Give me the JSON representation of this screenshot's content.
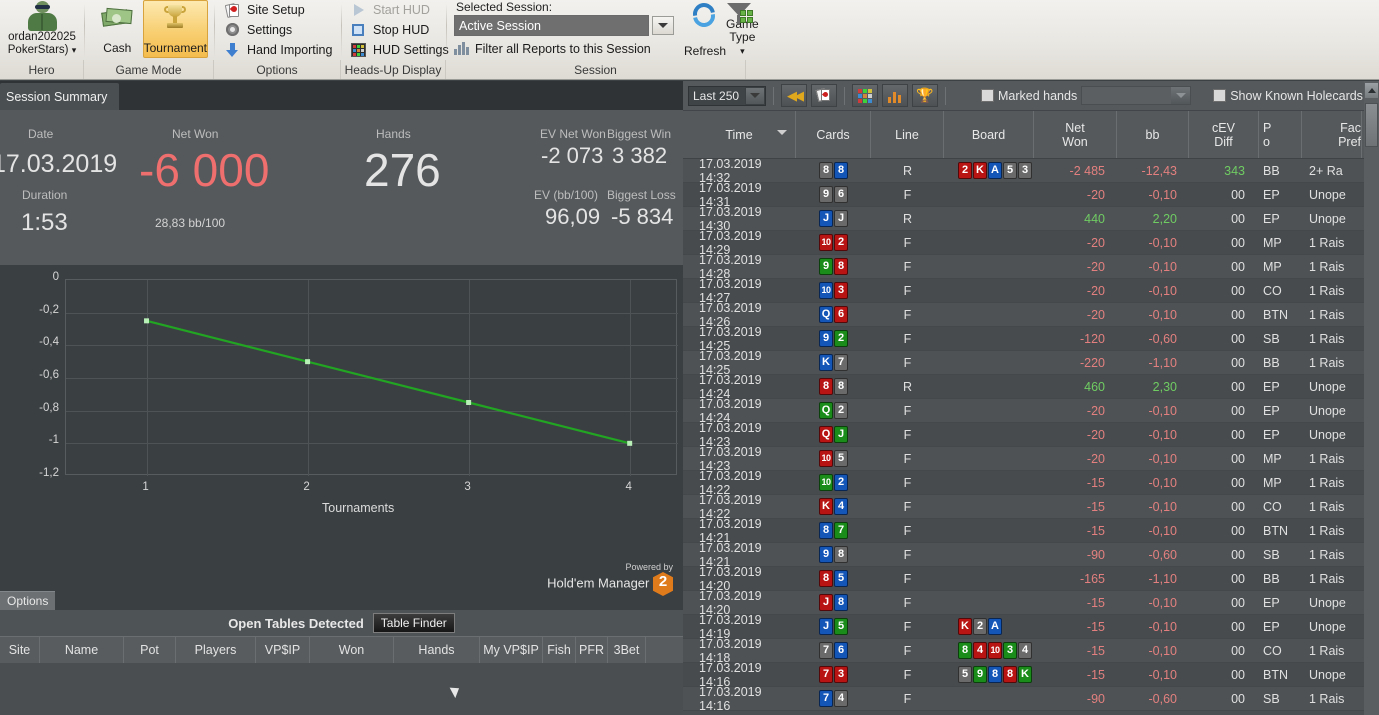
{
  "ribbon": {
    "hero": {
      "group_label": "Hero",
      "name_line1": "ordan202025",
      "name_line2": "PokerStars)",
      "avatar_icon": "user-avatar-icon"
    },
    "game_mode": {
      "group_label": "Game Mode",
      "cash_label": "Cash",
      "tournament_label": "Tournament",
      "selected": "Tournament"
    },
    "options": {
      "group_label": "Options",
      "items": [
        {
          "label": "Site Setup",
          "icon": "cards-icon"
        },
        {
          "label": "Settings",
          "icon": "gear-icon"
        },
        {
          "label": "Hand Importing",
          "icon": "download-arrow-icon"
        }
      ]
    },
    "hud": {
      "group_label": "Heads-Up Display",
      "items": [
        {
          "label": "Start HUD",
          "icon": "play-icon",
          "disabled": true
        },
        {
          "label": "Stop HUD",
          "icon": "stop-icon",
          "disabled": false
        },
        {
          "label": "HUD Settings",
          "icon": "hud-grid-icon",
          "disabled": false
        }
      ]
    },
    "session": {
      "group_label": "Session",
      "selected_session_label": "Selected Session:",
      "selected_session_value": "Active Session",
      "filter_label": "Filter all Reports to this Session",
      "refresh_label": "Refresh",
      "game_type_line1": "Game",
      "game_type_line2": "Type"
    }
  },
  "left_panel": {
    "tab_label": "Session Summary",
    "summary": {
      "date_label": "Date",
      "date_value": "17.03.2019",
      "duration_label": "Duration",
      "duration_value": "1:53",
      "netwon_label": "Net Won",
      "netwon_value": "-6 000",
      "netwon_sub": "28,83 bb/100",
      "hands_label": "Hands",
      "hands_value": "276",
      "ev_netwon_label": "EV Net Won",
      "ev_netwon_value": "-2 073",
      "biggest_win_label": "Biggest Win",
      "biggest_win_value": "3 382",
      "ev_bb_label": "EV (bb/100)",
      "ev_bb_value": "96,09",
      "biggest_loss_label": "Biggest Loss",
      "biggest_loss_value": "-5 834"
    },
    "chart_footer": {
      "options_button": "Options",
      "powered_by": "Powered by",
      "brand": "Hold'em Manager",
      "brand_badge": "2"
    },
    "tables": {
      "title": "Open Tables Detected",
      "finder_button": "Table Finder",
      "columns": [
        "Site",
        "Name",
        "Pot",
        "Players",
        "VP$IP",
        "Won",
        "Hands",
        "My VP$IP",
        "Fish",
        "PFR",
        "3Bet"
      ],
      "rows": []
    }
  },
  "chart_data": {
    "type": "line",
    "title": "",
    "xlabel": "Tournaments",
    "ylabel": "",
    "x": [
      1,
      2,
      3,
      4
    ],
    "values": [
      -0.25,
      -0.5,
      -0.75,
      -1.0
    ],
    "xticks": [
      "1",
      "2",
      "3",
      "4"
    ],
    "yticks": [
      "0",
      "-0,2",
      "-0,4",
      "-0,6",
      "-0,8",
      "-1",
      "-1,2"
    ],
    "ylim": [
      -1.2,
      0
    ],
    "xlim": [
      0.5,
      4.3
    ],
    "grid": true,
    "legend": "none",
    "line_color": "#22a522",
    "marker_color": "#b8f0b8"
  },
  "right_panel": {
    "toolbar": {
      "range_value": "Last 250",
      "marked_hands_label": "Marked hands",
      "marked_hands_value": "",
      "show_known_holecards_label": "Show Known Holecards",
      "buttons": [
        "rewind-icon",
        "cards-icon",
        "grid-icon",
        "bar-chart-icon",
        "trophy-icon"
      ]
    },
    "columns": [
      {
        "key": "time",
        "label": "Time",
        "sorted": true
      },
      {
        "key": "cards",
        "label": "Cards"
      },
      {
        "key": "line",
        "label": "Line"
      },
      {
        "key": "board",
        "label": "Board"
      },
      {
        "key": "net",
        "label": "Net\nWon",
        "l1": "Net",
        "l2": "Won"
      },
      {
        "key": "bb",
        "label": "bb"
      },
      {
        "key": "cev",
        "l1": "cEV",
        "l2": "Diff"
      },
      {
        "key": "pos",
        "l1": "P",
        "l2": "o"
      },
      {
        "key": "fac",
        "l1": "Fac",
        "l2": "Pref"
      }
    ],
    "rows": [
      {
        "time": "17.03.2019 14:32",
        "cards": [
          {
            "r": "8",
            "c": "s"
          },
          {
            "r": "8",
            "c": "b"
          }
        ],
        "line": "R",
        "board": [
          {
            "r": "2",
            "c": "r"
          },
          {
            "r": "K",
            "c": "r"
          },
          {
            "r": "A",
            "c": "b"
          },
          {
            "r": "5",
            "c": "s"
          },
          {
            "r": "3",
            "c": "s"
          }
        ],
        "net": "-2 485",
        "net_sign": "neg",
        "bb": "-12,43",
        "bb_sign": "neg",
        "cev": "343",
        "cev_sign": "pos",
        "pos": "BB",
        "fac": "2+ Ra"
      },
      {
        "time": "17.03.2019 14:31",
        "cards": [
          {
            "r": "9",
            "c": "s"
          },
          {
            "r": "6",
            "c": "s"
          }
        ],
        "line": "F",
        "board": [],
        "net": "-20",
        "net_sign": "neg",
        "bb": "-0,10",
        "bb_sign": "neg",
        "cev": "00",
        "cev_sign": "",
        "pos": "EP",
        "fac": "Unope"
      },
      {
        "time": "17.03.2019 14:30",
        "cards": [
          {
            "r": "J",
            "c": "b"
          },
          {
            "r": "J",
            "c": "s"
          }
        ],
        "line": "R",
        "board": [],
        "net": "440",
        "net_sign": "pos",
        "bb": "2,20",
        "bb_sign": "pos",
        "cev": "00",
        "cev_sign": "",
        "pos": "EP",
        "fac": "Unope"
      },
      {
        "time": "17.03.2019 14:29",
        "cards": [
          {
            "r": "10",
            "c": "r"
          },
          {
            "r": "2",
            "c": "r"
          }
        ],
        "line": "F",
        "board": [],
        "net": "-20",
        "net_sign": "neg",
        "bb": "-0,10",
        "bb_sign": "neg",
        "cev": "00",
        "cev_sign": "",
        "pos": "MP",
        "fac": "1 Rais"
      },
      {
        "time": "17.03.2019 14:28",
        "cards": [
          {
            "r": "9",
            "c": "g"
          },
          {
            "r": "8",
            "c": "r"
          }
        ],
        "line": "F",
        "board": [],
        "net": "-20",
        "net_sign": "neg",
        "bb": "-0,10",
        "bb_sign": "neg",
        "cev": "00",
        "cev_sign": "",
        "pos": "MP",
        "fac": "1 Rais"
      },
      {
        "time": "17.03.2019 14:27",
        "cards": [
          {
            "r": "10",
            "c": "b"
          },
          {
            "r": "3",
            "c": "r"
          }
        ],
        "line": "F",
        "board": [],
        "net": "-20",
        "net_sign": "neg",
        "bb": "-0,10",
        "bb_sign": "neg",
        "cev": "00",
        "cev_sign": "",
        "pos": "CO",
        "fac": "1 Rais"
      },
      {
        "time": "17.03.2019 14:26",
        "cards": [
          {
            "r": "Q",
            "c": "b"
          },
          {
            "r": "6",
            "c": "r"
          }
        ],
        "line": "F",
        "board": [],
        "net": "-20",
        "net_sign": "neg",
        "bb": "-0,10",
        "bb_sign": "neg",
        "cev": "00",
        "cev_sign": "",
        "pos": "BTN",
        "fac": "1 Rais"
      },
      {
        "time": "17.03.2019 14:25",
        "cards": [
          {
            "r": "9",
            "c": "b"
          },
          {
            "r": "2",
            "c": "g"
          }
        ],
        "line": "F",
        "board": [],
        "net": "-120",
        "net_sign": "neg",
        "bb": "-0,60",
        "bb_sign": "neg",
        "cev": "00",
        "cev_sign": "",
        "pos": "SB",
        "fac": "1 Rais"
      },
      {
        "time": "17.03.2019 14:25",
        "cards": [
          {
            "r": "K",
            "c": "b"
          },
          {
            "r": "7",
            "c": "s"
          }
        ],
        "line": "F",
        "board": [],
        "net": "-220",
        "net_sign": "neg",
        "bb": "-1,10",
        "bb_sign": "neg",
        "cev": "00",
        "cev_sign": "",
        "pos": "BB",
        "fac": "1 Rais"
      },
      {
        "time": "17.03.2019 14:24",
        "cards": [
          {
            "r": "8",
            "c": "r"
          },
          {
            "r": "8",
            "c": "s"
          }
        ],
        "line": "R",
        "board": [],
        "net": "460",
        "net_sign": "pos",
        "bb": "2,30",
        "bb_sign": "pos",
        "cev": "00",
        "cev_sign": "",
        "pos": "EP",
        "fac": "Unope"
      },
      {
        "time": "17.03.2019 14:24",
        "cards": [
          {
            "r": "Q",
            "c": "g"
          },
          {
            "r": "2",
            "c": "s"
          }
        ],
        "line": "F",
        "board": [],
        "net": "-20",
        "net_sign": "neg",
        "bb": "-0,10",
        "bb_sign": "neg",
        "cev": "00",
        "cev_sign": "",
        "pos": "EP",
        "fac": "Unope"
      },
      {
        "time": "17.03.2019 14:23",
        "cards": [
          {
            "r": "Q",
            "c": "r"
          },
          {
            "r": "J",
            "c": "g"
          }
        ],
        "line": "F",
        "board": [],
        "net": "-20",
        "net_sign": "neg",
        "bb": "-0,10",
        "bb_sign": "neg",
        "cev": "00",
        "cev_sign": "",
        "pos": "EP",
        "fac": "Unope"
      },
      {
        "time": "17.03.2019 14:23",
        "cards": [
          {
            "r": "10",
            "c": "r"
          },
          {
            "r": "5",
            "c": "s"
          }
        ],
        "line": "F",
        "board": [],
        "net": "-20",
        "net_sign": "neg",
        "bb": "-0,10",
        "bb_sign": "neg",
        "cev": "00",
        "cev_sign": "",
        "pos": "MP",
        "fac": "1 Rais"
      },
      {
        "time": "17.03.2019 14:22",
        "cards": [
          {
            "r": "10",
            "c": "g"
          },
          {
            "r": "2",
            "c": "b"
          }
        ],
        "line": "F",
        "board": [],
        "net": "-15",
        "net_sign": "neg",
        "bb": "-0,10",
        "bb_sign": "neg",
        "cev": "00",
        "cev_sign": "",
        "pos": "MP",
        "fac": "1 Rais"
      },
      {
        "time": "17.03.2019 14:22",
        "cards": [
          {
            "r": "K",
            "c": "r"
          },
          {
            "r": "4",
            "c": "b"
          }
        ],
        "line": "F",
        "board": [],
        "net": "-15",
        "net_sign": "neg",
        "bb": "-0,10",
        "bb_sign": "neg",
        "cev": "00",
        "cev_sign": "",
        "pos": "CO",
        "fac": "1 Rais"
      },
      {
        "time": "17.03.2019 14:21",
        "cards": [
          {
            "r": "8",
            "c": "b"
          },
          {
            "r": "7",
            "c": "g"
          }
        ],
        "line": "F",
        "board": [],
        "net": "-15",
        "net_sign": "neg",
        "bb": "-0,10",
        "bb_sign": "neg",
        "cev": "00",
        "cev_sign": "",
        "pos": "BTN",
        "fac": "1 Rais"
      },
      {
        "time": "17.03.2019 14:21",
        "cards": [
          {
            "r": "9",
            "c": "b"
          },
          {
            "r": "8",
            "c": "s"
          }
        ],
        "line": "F",
        "board": [],
        "net": "-90",
        "net_sign": "neg",
        "bb": "-0,60",
        "bb_sign": "neg",
        "cev": "00",
        "cev_sign": "",
        "pos": "SB",
        "fac": "1 Rais"
      },
      {
        "time": "17.03.2019 14:20",
        "cards": [
          {
            "r": "8",
            "c": "r"
          },
          {
            "r": "5",
            "c": "b"
          }
        ],
        "line": "F",
        "board": [],
        "net": "-165",
        "net_sign": "neg",
        "bb": "-1,10",
        "bb_sign": "neg",
        "cev": "00",
        "cev_sign": "",
        "pos": "BB",
        "fac": "1 Rais"
      },
      {
        "time": "17.03.2019 14:20",
        "cards": [
          {
            "r": "J",
            "c": "r"
          },
          {
            "r": "8",
            "c": "b"
          }
        ],
        "line": "F",
        "board": [],
        "net": "-15",
        "net_sign": "neg",
        "bb": "-0,10",
        "bb_sign": "neg",
        "cev": "00",
        "cev_sign": "",
        "pos": "EP",
        "fac": "Unope"
      },
      {
        "time": "17.03.2019 14:19",
        "cards": [
          {
            "r": "J",
            "c": "b"
          },
          {
            "r": "5",
            "c": "g"
          }
        ],
        "line": "F",
        "board": [
          {
            "r": "K",
            "c": "r"
          },
          {
            "r": "2",
            "c": "s"
          },
          {
            "r": "A",
            "c": "b"
          }
        ],
        "net": "-15",
        "net_sign": "neg",
        "bb": "-0,10",
        "bb_sign": "neg",
        "cev": "00",
        "cev_sign": "",
        "pos": "EP",
        "fac": "Unope"
      },
      {
        "time": "17.03.2019 14:18",
        "cards": [
          {
            "r": "7",
            "c": "s"
          },
          {
            "r": "6",
            "c": "b"
          }
        ],
        "line": "F",
        "board": [
          {
            "r": "8",
            "c": "g"
          },
          {
            "r": "4",
            "c": "r"
          },
          {
            "r": "10",
            "c": "r"
          },
          {
            "r": "3",
            "c": "g"
          },
          {
            "r": "4",
            "c": "s"
          }
        ],
        "net": "-15",
        "net_sign": "neg",
        "bb": "-0,10",
        "bb_sign": "neg",
        "cev": "00",
        "cev_sign": "",
        "pos": "CO",
        "fac": "1 Rais"
      },
      {
        "time": "17.03.2019 14:16",
        "cards": [
          {
            "r": "7",
            "c": "r"
          },
          {
            "r": "3",
            "c": "r"
          }
        ],
        "line": "F",
        "board": [
          {
            "r": "5",
            "c": "s"
          },
          {
            "r": "9",
            "c": "g"
          },
          {
            "r": "8",
            "c": "b"
          },
          {
            "r": "8",
            "c": "r"
          },
          {
            "r": "K",
            "c": "g"
          }
        ],
        "net": "-15",
        "net_sign": "neg",
        "bb": "-0,10",
        "bb_sign": "neg",
        "cev": "00",
        "cev_sign": "",
        "pos": "BTN",
        "fac": "Unope"
      },
      {
        "time": "17.03.2019 14:16",
        "cards": [
          {
            "r": "7",
            "c": "b"
          },
          {
            "r": "4",
            "c": "s"
          }
        ],
        "line": "F",
        "board": [],
        "net": "-90",
        "net_sign": "neg",
        "bb": "-0,60",
        "bb_sign": "neg",
        "cev": "00",
        "cev_sign": "",
        "pos": "SB",
        "fac": "1 Rais"
      }
    ]
  }
}
